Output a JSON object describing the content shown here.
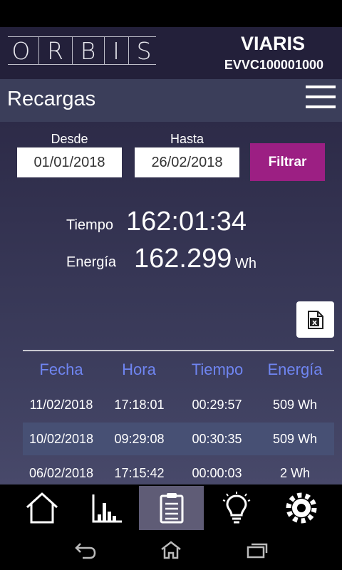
{
  "header": {
    "logo_letters": [
      "O",
      "R",
      "B",
      "I",
      "S"
    ],
    "brand": "VIARIS",
    "serial": "EVVC100001000"
  },
  "page": {
    "title": "Recargas"
  },
  "filter": {
    "from_label": "Desde",
    "from_value": "01/01/2018",
    "to_label": "Hasta",
    "to_value": "26/02/2018",
    "button": "Filtrar"
  },
  "summary": {
    "time_label": "Tiempo",
    "time_value": "162:01:34",
    "energy_label": "Energía",
    "energy_value": "162.299",
    "energy_unit": "Wh"
  },
  "export": {
    "icon": "excel-icon",
    "letter": "x"
  },
  "table": {
    "headers": [
      "Fecha",
      "Hora",
      "Tiempo",
      "Energía"
    ],
    "rows": [
      [
        "11/02/2018",
        "17:18:01",
        "00:29:57",
        "509 Wh"
      ],
      [
        "10/02/2018",
        "09:29:08",
        "00:30:35",
        "509 Wh"
      ],
      [
        "06/02/2018",
        "17:15:42",
        "00:00:03",
        "2 Wh"
      ]
    ]
  },
  "nav": {
    "items": [
      "home-icon",
      "chart-icon",
      "clipboard-icon",
      "lightbulb-icon",
      "gear-icon"
    ],
    "active": 2
  },
  "colors": {
    "accent": "#9c1f83",
    "table_header": "#6f85f1",
    "title_bar": "#3b3e5a"
  }
}
